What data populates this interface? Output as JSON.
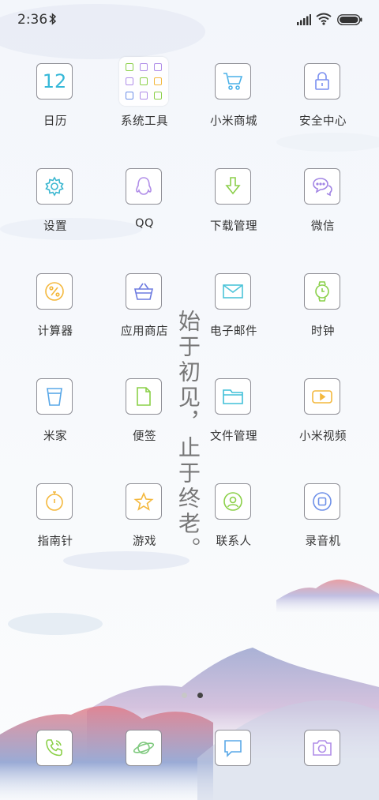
{
  "status": {
    "time": "2:36"
  },
  "apps": [
    {
      "label": "日历",
      "icon": "calendar-icon",
      "text": "12",
      "color": "#35b8d8"
    },
    {
      "label": "系统工具",
      "icon": "folder-icon",
      "color": "#999"
    },
    {
      "label": "小米商城",
      "icon": "cart-icon",
      "color": "#4ab1e8"
    },
    {
      "label": "安全中心",
      "icon": "lock-icon",
      "color": "#7a8ff0"
    },
    {
      "label": "设置",
      "icon": "gear-icon",
      "color": "#3bb7d0"
    },
    {
      "label": "QQ",
      "icon": "penguin-icon",
      "color": "#b08de8"
    },
    {
      "label": "下载管理",
      "icon": "download-icon",
      "color": "#8bcf4a"
    },
    {
      "label": "微信",
      "icon": "chat-bubbles-icon",
      "color": "#a184e4"
    },
    {
      "label": "计算器",
      "icon": "percent-icon",
      "color": "#f4b83d"
    },
    {
      "label": "应用商店",
      "icon": "basket-icon",
      "color": "#6d7be0"
    },
    {
      "label": "电子邮件",
      "icon": "mail-icon",
      "color": "#4cc4d9"
    },
    {
      "label": "时钟",
      "icon": "watch-icon",
      "color": "#8ad04a"
    },
    {
      "label": "米家",
      "icon": "cup-icon",
      "color": "#5aa8e8"
    },
    {
      "label": "便签",
      "icon": "note-icon",
      "color": "#8bd048"
    },
    {
      "label": "文件管理",
      "icon": "folder-file-icon",
      "color": "#40c0d8"
    },
    {
      "label": "小米视频",
      "icon": "video-icon",
      "color": "#f4b83d"
    },
    {
      "label": "指南针",
      "icon": "stopwatch-icon",
      "color": "#f4b83d"
    },
    {
      "label": "游戏",
      "icon": "star-icon",
      "color": "#f4b83d"
    },
    {
      "label": "联系人",
      "icon": "contact-icon",
      "color": "#8bd048"
    },
    {
      "label": "录音机",
      "icon": "record-icon",
      "color": "#6d8fe8"
    }
  ],
  "tagline": "始于初见，止于终老。",
  "dock": [
    {
      "icon": "phone-icon",
      "color": "#8bd048"
    },
    {
      "icon": "planet-icon",
      "color": "#7fc97e"
    },
    {
      "icon": "message-icon",
      "color": "#5aa8e8"
    },
    {
      "icon": "camera-icon",
      "color": "#b08de8"
    }
  ],
  "pager": {
    "active": 1,
    "count": 2
  }
}
